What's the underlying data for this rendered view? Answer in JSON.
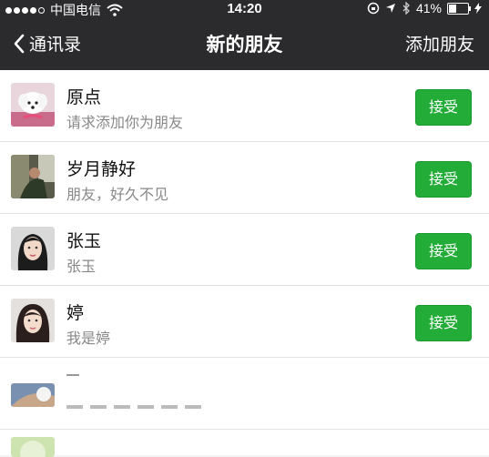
{
  "status_bar": {
    "carrier": "中国电信",
    "time": "14:20",
    "battery": "41%",
    "battery_level": 0.41,
    "signal_dots": [
      true,
      true,
      true,
      true,
      false
    ]
  },
  "nav": {
    "back_label": "通讯录",
    "title": "新的朋友",
    "action_label": "添加朋友"
  },
  "requests": [
    {
      "name": "原点",
      "message": "请求添加你为朋友",
      "button": "接受"
    },
    {
      "name": "岁月静好",
      "message": "朋友，好久不见",
      "button": "接受"
    },
    {
      "name": "张玉",
      "message": "张玉",
      "button": "接受"
    },
    {
      "name": "婷",
      "message": "我是婷",
      "button": "接受"
    }
  ],
  "colors": {
    "nav_bg": "#2b2b2e",
    "accept_green": "#23ad38"
  }
}
